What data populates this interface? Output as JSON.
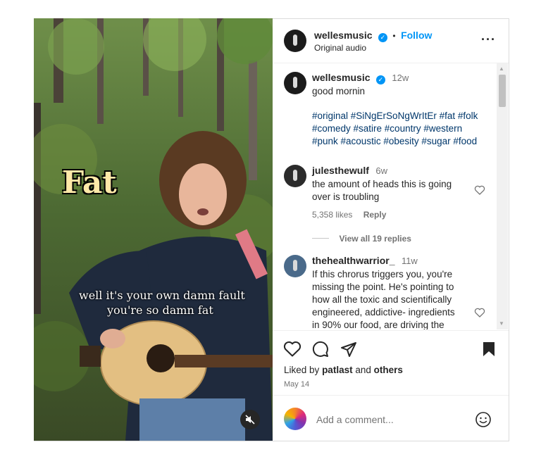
{
  "video": {
    "overlay_title": "Fat",
    "subtitle_line1": "well it's your own damn fault",
    "subtitle_line2": "you're so damn fat",
    "mute_icon": "muted-speaker-icon"
  },
  "header": {
    "username": "wellesmusic",
    "separator": "•",
    "follow_label": "Follow",
    "audio_label": "Original audio",
    "more_icon": "more-options-icon"
  },
  "post": {
    "username": "wellesmusic",
    "time": "12w",
    "caption": "good mornin",
    "hashtags_line1": "#original #SiNgErSoNgWrItEr #fat #folk",
    "hashtags_line2": "#comedy #satire #country #western",
    "hashtags_line3": "#punk #acoustic #obesity #sugar #food"
  },
  "comments": [
    {
      "username": "julesthewulf",
      "time": "6w",
      "line1": "the amount of heads this is going",
      "line2": "over is troubling",
      "likes": "5,358 likes",
      "reply_label": "Reply",
      "view_replies": "View all 19 replies"
    },
    {
      "username": "thehealthwarrior_",
      "time": "11w",
      "line1": "If this chrorus triggers you, you're",
      "line2": "missing the point. He's pointing to",
      "line3": "how all the toxic and scientifically",
      "line4": "engineered, addictive- ingredients",
      "line5": "in 90% our food, are driving the"
    }
  ],
  "actions": {
    "liked_prefix": "Liked by",
    "liked_user": "patlast",
    "liked_and": "and",
    "liked_others": "others",
    "date": "May 14"
  },
  "add_comment": {
    "placeholder": "Add a comment..."
  },
  "colors": {
    "accent": "#0095f6",
    "hashtag": "#00376b",
    "muted": "#737373"
  }
}
